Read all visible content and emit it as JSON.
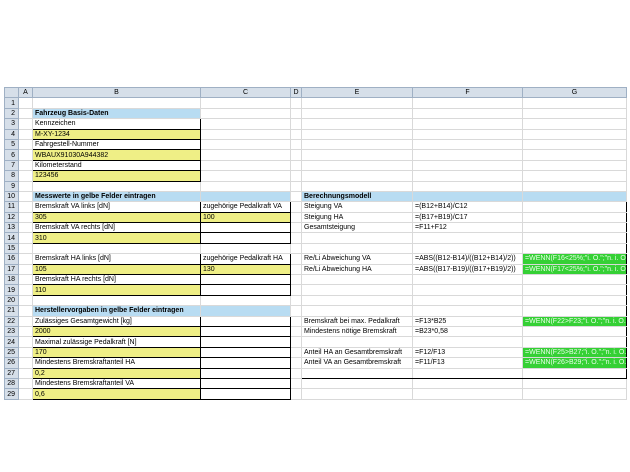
{
  "columns": [
    "",
    "A",
    "B",
    "C",
    "D",
    "E",
    "F",
    "G"
  ],
  "rows": [
    "1",
    "2",
    "3",
    "4",
    "5",
    "6",
    "7",
    "8",
    "9",
    "10",
    "11",
    "12",
    "13",
    "14",
    "15",
    "16",
    "17",
    "18",
    "19",
    "20",
    "21",
    "22",
    "23",
    "24",
    "25",
    "26",
    "27",
    "28",
    "29"
  ],
  "cells": {
    "B2": "Fahrzeug Basis-Daten",
    "B3": "Kennzeichen",
    "B4": "M-XY-1234",
    "B5": "Fahrgestell-Nummer",
    "B6": "WBAUX91030A944382",
    "B7": "Kilometerstand",
    "B8": "123456",
    "B10": "Messwerte in gelbe Felder eintragen",
    "B11": "Bremskraft VA links  [dN]",
    "C11": "zugehörige Pedalkraft VA",
    "B12": "305",
    "C12": "100",
    "B13": "Bremskraft VA rechts  [dN]",
    "B14": "310",
    "B16": "Bremskraft HA links  [dN]",
    "C16": "zugehörige Pedalkraft HA",
    "B17": "105",
    "C17": "130",
    "B18": "Bremskraft HA rechts  [dN]",
    "B19": "110",
    "B21": "Herstellervorgaben  in gelbe Felder eintragen",
    "B22": "Zulässiges Gesamtgewicht [kg]",
    "B23": "2000",
    "B24": "Maximal zulässige Pedalkraft [N]",
    "B25": "170",
    "B26": "Mindestens Bremskraftanteil HA",
    "B27": "0,2",
    "B28": "Mindestens Bremskraftanteil VA",
    "B29": "0,6",
    "E10": "Berechnungsmodell",
    "E11": "Steigung VA",
    "F11": "=(B12+B14)/C12",
    "E12": "Steigung HA",
    "F12": "=(B17+B19)/C17",
    "E13": "Gesamtsteigung",
    "F13": "=F11+F12",
    "E16": "Re/Li Abweichung VA",
    "F16": "=ABS((B12-B14)/((B12+B14)/2))",
    "G16": "=WENN(F16<25%;\"i. O.\";\"n. i. O.\")",
    "E17": "Re/Li Abweichung HA",
    "F17": "=ABS((B17-B19)/((B17+B19)/2))",
    "G17": "=WENN(F17<25%;\"i. O.\";\"n. i. O.\")",
    "E22": "Bremskraft bei max. Pedalkraft",
    "F22": "=F13*B25",
    "G22": "=WENN(F22>F23;\"i. O.\";\"n. i. O.\")",
    "E23": "Mindestens nötige Bremskraft",
    "F23": "=B23*0,58",
    "E25": "Anteil HA an Gesamtbremskraft",
    "F25": "=F12/F13",
    "G25": "=WENN(F25>B27;\"i. O.\";\"n. i. O.\")",
    "E26": "Anteil VA an Gesamtbremskraft",
    "F26": "=F11/F13",
    "G26": "=WENN(F26>B29;\"i. O.\";\"n. i. O.\")"
  },
  "colors": {
    "header_blue": "#b8dcf2",
    "input_yellow": "#efef86",
    "result_green": "#35d035",
    "grid": "#d9d9d9"
  }
}
